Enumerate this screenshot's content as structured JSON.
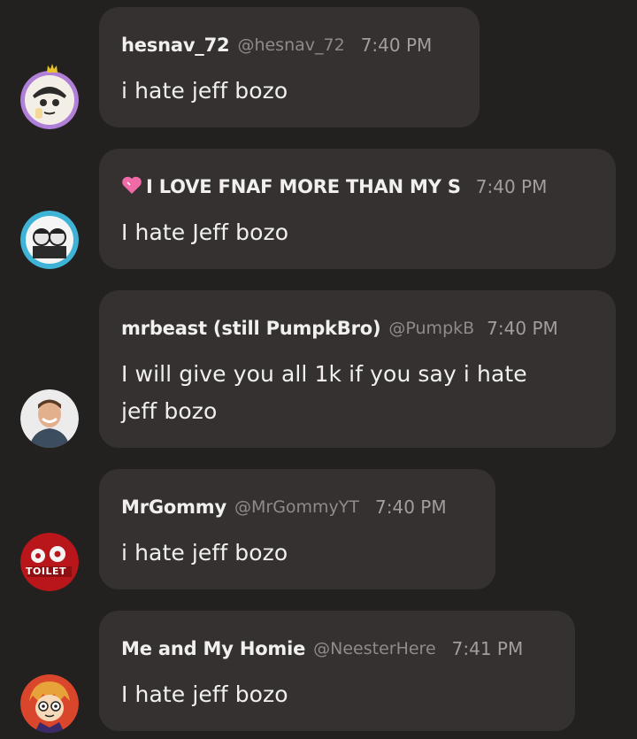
{
  "messages": [
    {
      "author": "hesnav_72",
      "handle": "@hesnav_72",
      "time": "7:40 PM",
      "text": "i hate jeff bozo",
      "avatar_icon": "cartoon-character-avatar-icon"
    },
    {
      "author": "I LOVE FNAF MORE THAN MY S",
      "author_prefix_icon": "pink-heart-emoji-icon",
      "handle": "",
      "time": "7:40 PM",
      "text": "I hate Jeff bozo",
      "avatar_icon": "two-characters-avatar-icon"
    },
    {
      "author": "mrbeast (still PumpkBro)",
      "handle": "@PumpkB",
      "time": "7:40 PM",
      "text_line1": "I will give you all 1k if you say i hate",
      "text_line2": "jeff bozo",
      "avatar_icon": "smiling-man-avatar-icon"
    },
    {
      "author": "MrGommy",
      "handle": "@MrGommyYT",
      "time": "7:40 PM",
      "text": "i hate jeff bozo",
      "avatar_icon": "toilet-logo-avatar-icon",
      "avatar_text": "TOILET"
    },
    {
      "author": "Me and My Homie",
      "handle": "@NeesterHere",
      "time": "7:41 PM",
      "text": "I hate jeff bozo",
      "avatar_icon": "cartoon-boy-avatar-icon"
    }
  ],
  "colors": {
    "background": "#232120",
    "bubble": "#343130",
    "name_text": "#f2f0ef",
    "handle_text": "#8f8b89",
    "time_text": "#a29e9c"
  }
}
